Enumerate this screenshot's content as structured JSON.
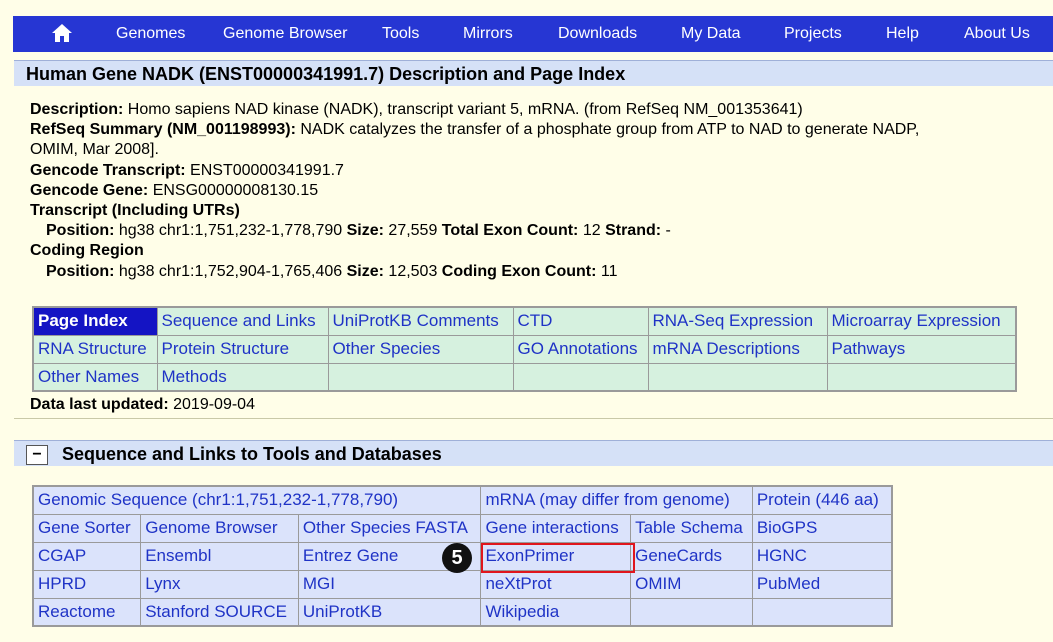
{
  "nav": {
    "items": [
      "Genomes",
      "Genome Browser",
      "Tools",
      "Mirrors",
      "Downloads",
      "My Data",
      "Projects",
      "Help",
      "About Us"
    ]
  },
  "section1": {
    "title": "Human Gene NADK (ENST00000341991.7) Description and Page Index"
  },
  "description": {
    "desc_label": "Description:",
    "desc_value": " Homo sapiens NAD kinase (NADK), transcript variant 5, mRNA. (from RefSeq NM_001353641)",
    "refseq_label": "RefSeq Summary (NM_001198993):",
    "refseq_value": " NADK catalyzes the transfer of a phosphate group from ATP to NAD to generate NADP,",
    "refseq_cont": "OMIM, Mar 2008].",
    "gencode_tx_label": "Gencode Transcript:",
    "gencode_tx_value": " ENST00000341991.7",
    "gencode_gene_label": "Gencode Gene:",
    "gencode_gene_value": " ENSG00000008130.15",
    "transcript_label": "Transcript (Including UTRs)",
    "t_position_label": "Position:",
    "t_position_value": " hg38 chr1:1,751,232-1,778,790 ",
    "t_size_label": "Size:",
    "t_size_value": " 27,559 ",
    "t_exon_label": "Total Exon Count:",
    "t_exon_value": " 12 ",
    "t_strand_label": "Strand:",
    "t_strand_value": " -",
    "coding_label": "Coding Region",
    "c_position_label": "Position:",
    "c_position_value": " hg38 chr1:1,752,904-1,765,406 ",
    "c_size_label": "Size:",
    "c_size_value": " 12,503 ",
    "c_exon_label": "Coding Exon Count:",
    "c_exon_value": " 11"
  },
  "page_index": {
    "rows": [
      [
        "Page Index",
        "Sequence and Links",
        "UniProtKB Comments",
        "CTD",
        "RNA-Seq Expression",
        "Microarray Expression"
      ],
      [
        "RNA Structure",
        "Protein Structure",
        "Other Species",
        "GO Annotations",
        "mRNA Descriptions",
        "Pathways"
      ],
      [
        "Other Names",
        "Methods",
        "",
        "",
        "",
        ""
      ]
    ]
  },
  "updated": {
    "label": "Data last updated:",
    "value": " 2019-09-04"
  },
  "section2": {
    "toggle": "−",
    "title": "Sequence and Links to Tools and Databases"
  },
  "links": {
    "genomic_sequence": "Genomic Sequence (chr1:1,751,232-1,778,790)",
    "mrna": "mRNA (may differ from genome)",
    "protein": "Protein (446 aa)",
    "rows": [
      [
        "Gene Sorter",
        "Genome Browser",
        "Other Species FASTA",
        "Gene interactions",
        "Table Schema",
        "BioGPS"
      ],
      [
        "CGAP",
        "Ensembl",
        "Entrez Gene",
        "ExonPrimer",
        "GeneCards",
        "HGNC"
      ],
      [
        "HPRD",
        "Lynx",
        "MGI",
        "neXtProt",
        "OMIM",
        "PubMed"
      ],
      [
        "Reactome",
        "Stanford SOURCE",
        "UniProtKB",
        "Wikipedia",
        "",
        ""
      ]
    ]
  },
  "annotation": {
    "badge": "5"
  }
}
